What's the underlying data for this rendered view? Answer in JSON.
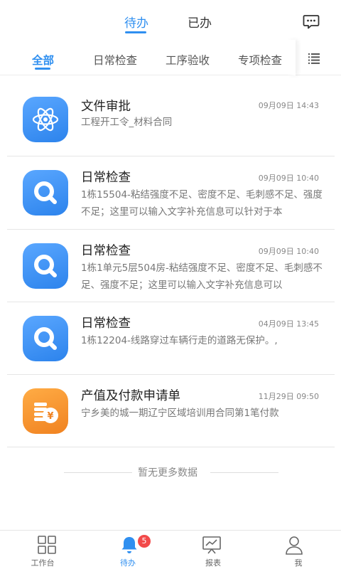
{
  "top_tabs": [
    {
      "label": "待办",
      "active": true
    },
    {
      "label": "已办",
      "active": false
    }
  ],
  "header": {
    "message_icon": "chat-bubble-icon"
  },
  "categories": [
    {
      "label": "全部",
      "active": true
    },
    {
      "label": "日常检查"
    },
    {
      "label": "工序验收"
    },
    {
      "label": "专项检查"
    }
  ],
  "category_menu_icon": "list-icon",
  "items": [
    {
      "icon": "atom-icon",
      "title": "文件审批",
      "time": "09月09日 14:43",
      "desc": "工程开工令_材料合同"
    },
    {
      "icon": "magnifier-icon",
      "title": "日常检查",
      "time": "09月09日 10:40",
      "desc": "1栋15504-粘结强度不足、密度不足、毛刺感不足、强度不足；这里可以输入文字补充信息可以针对于本"
    },
    {
      "icon": "magnifier-icon",
      "title": "日常检查",
      "time": "09月09日 10:40",
      "desc": "1栋1单元5层504房-粘结强度不足、密度不足、毛刺感不足、强度不足；这里可以输入文字补充信息可以"
    },
    {
      "icon": "magnifier-icon",
      "title": "日常检查",
      "time": "04月09日 13:45",
      "desc": "1栋12204-线路穿过车辆行走的道路无保护。,"
    },
    {
      "icon": "coins-icon",
      "title": "产值及付款申请单",
      "time": "11月29日 09:50",
      "desc": "宁乡美的城一期辽宁区域培训用合同第1笔付款"
    }
  ],
  "no_more": "暂无更多数据",
  "bottom_nav": [
    {
      "label": "工作台",
      "icon": "grid-icon"
    },
    {
      "label": "待办",
      "icon": "bell-icon",
      "badge": "5",
      "active": true
    },
    {
      "label": "报表",
      "icon": "chart-board-icon"
    },
    {
      "label": "我",
      "icon": "person-icon"
    }
  ],
  "colors": {
    "accent": "#2f8ff0",
    "badge": "#f24a4a",
    "icon_blue": "#3a8ef2",
    "icon_orange": "#f7962f"
  }
}
